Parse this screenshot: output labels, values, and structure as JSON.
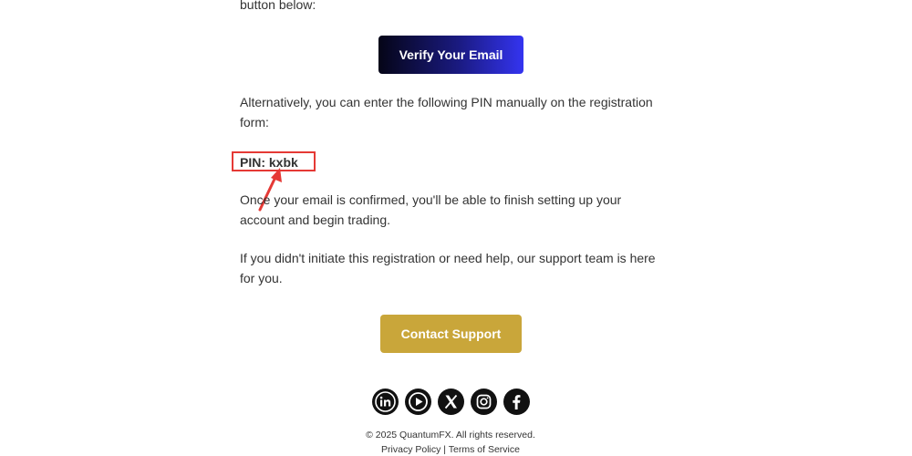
{
  "email": {
    "intro_tail": "button below:",
    "verify_button_label": "Verify Your Email",
    "alternative_text": "Alternatively, you can enter the following PIN manually on the registration form:",
    "pin_text": "PIN: kxbk",
    "confirmed_text": "Once your email is confirmed, you'll be able to finish setting up your account and begin trading.",
    "help_text": "If you didn't initiate this registration or need help, our support team is here for you.",
    "support_button_label": "Contact Support"
  },
  "socials": [
    "linkedin-icon",
    "youtube-icon",
    "x-icon",
    "instagram-icon",
    "facebook-icon"
  ],
  "footer": {
    "copyright": "© 2025 QuantumFX. All rights reserved.",
    "privacy_label": "Privacy Policy",
    "separator": " | ",
    "terms_label": "Terms of Service"
  },
  "colors": {
    "verify_gradient_start": "#050517",
    "verify_gradient_end": "#3434f0",
    "support_button": "#c9a63a",
    "annotation_red": "#e53935",
    "icon_dark": "#111111"
  }
}
